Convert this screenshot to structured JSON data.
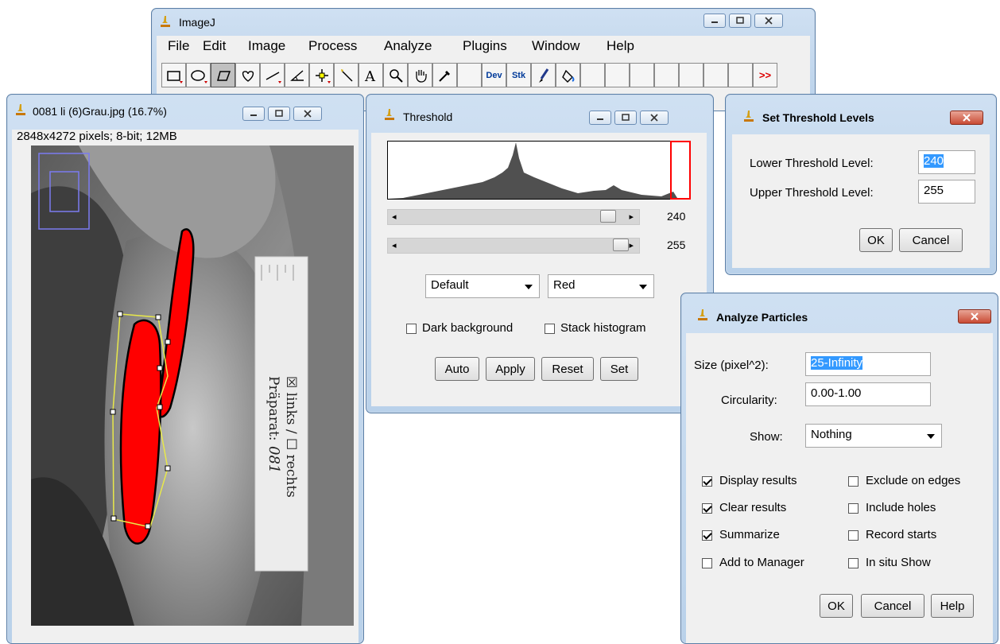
{
  "imagej": {
    "title": "ImageJ",
    "menu": [
      "File",
      "Edit",
      "Image",
      "Process",
      "Analyze",
      "Plugins",
      "Window",
      "Help"
    ],
    "tools": [
      "rectangle",
      "oval",
      "polygon",
      "freehand",
      "line",
      "angle",
      "point",
      "wand",
      "text",
      "magnifier",
      "hand",
      "dropper"
    ],
    "dev_label": "Dev",
    "stk_label": "Stk",
    "more_label": ">>"
  },
  "image_window": {
    "title": "0081 li (6)Grau.jpg (16.7%)",
    "info": "2848x4272 pixels; 8-bit; 12MB",
    "label_card_text": [
      "Präparat:",
      "☒ links / ☐ rechts"
    ],
    "label_card_handwriting": "081"
  },
  "threshold": {
    "title": "Threshold",
    "lower_value": "240",
    "upper_value": "255",
    "lower_fraction": 0.94,
    "upper_fraction": 1.0,
    "method": "Default",
    "display": "Red",
    "dark_background_label": "Dark background",
    "dark_background_checked": false,
    "stack_histogram_label": "Stack histogram",
    "stack_histogram_checked": false,
    "buttons": [
      "Auto",
      "Apply",
      "Reset",
      "Set"
    ]
  },
  "set_threshold": {
    "title": "Set Threshold Levels",
    "lower_label": "Lower Threshold Level:",
    "lower_value": "240",
    "upper_label": "Upper Threshold Level:",
    "upper_value": "255",
    "ok": "OK",
    "cancel": "Cancel"
  },
  "analyze": {
    "title": "Analyze Particles",
    "size_label": "Size (pixel^2):",
    "size_value": "25-Infinity",
    "circ_label": "Circularity:",
    "circ_value": "0.00-1.00",
    "show_label": "Show:",
    "show_value": "Nothing",
    "options": [
      {
        "label": "Display results",
        "checked": true
      },
      {
        "label": "Exclude on edges",
        "checked": false
      },
      {
        "label": "Clear results",
        "checked": true
      },
      {
        "label": "Include holes",
        "checked": false
      },
      {
        "label": "Summarize",
        "checked": true
      },
      {
        "label": "Record starts",
        "checked": false
      },
      {
        "label": "Add to Manager",
        "checked": false
      },
      {
        "label": "In situ Show",
        "checked": false
      }
    ],
    "ok": "OK",
    "cancel": "Cancel",
    "help": "Help"
  },
  "colors": {
    "threshold_red": "#ff0000",
    "titlebar": "#c4d8ee",
    "selection": "#3399ff"
  }
}
